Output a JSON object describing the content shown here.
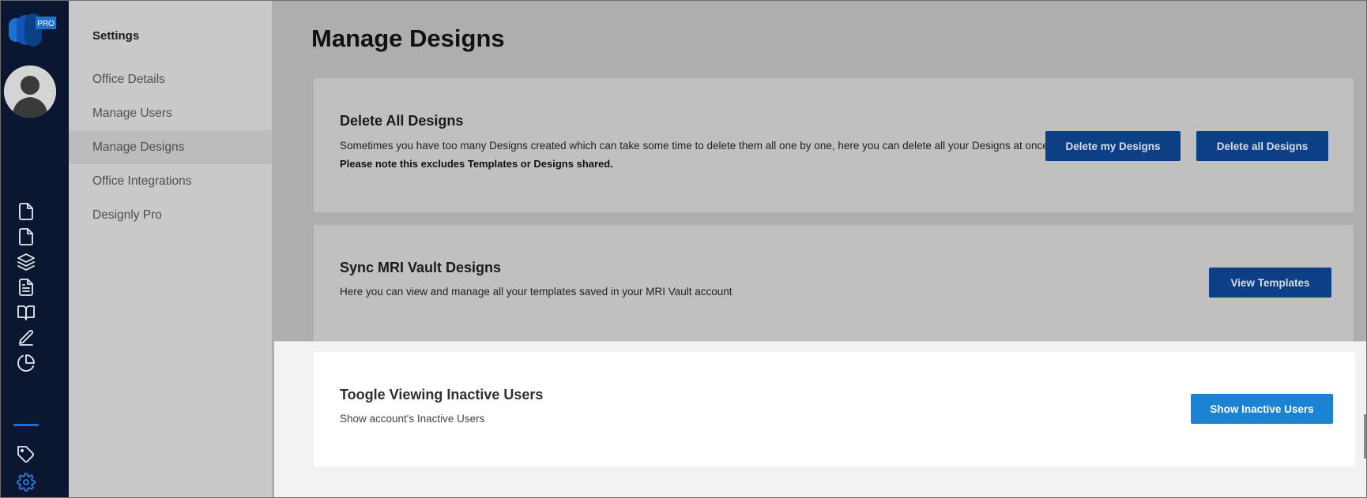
{
  "app": {
    "badge": "PRO"
  },
  "settings": {
    "title": "Settings",
    "items": [
      {
        "label": "Office Details",
        "selected": false
      },
      {
        "label": "Manage Users",
        "selected": false
      },
      {
        "label": "Manage Designs",
        "selected": true
      },
      {
        "label": "Office Integrations",
        "selected": false
      },
      {
        "label": "Designly Pro",
        "selected": false
      }
    ]
  },
  "rail": {
    "icons": [
      "document-icon",
      "document-icon",
      "layers-icon",
      "file-text-icon",
      "book-open-icon",
      "edit-icon",
      "pie-chart-icon",
      "tag-icon",
      "settings-icon"
    ]
  },
  "main": {
    "title": "Manage Designs",
    "cards": [
      {
        "title": "Delete All Designs",
        "description": "Sometimes you have too many Designs created which can take some time to delete them all one by one, here you can delete all your Designs at once.",
        "note": "Please note this excludes Templates or Designs shared.",
        "buttons": [
          "Delete my Designs",
          "Delete all Designs"
        ]
      },
      {
        "title": "Sync MRI Vault Designs",
        "description": "Here you can view and manage all your templates saved in your MRI Vault account",
        "buttons": [
          "View Templates"
        ]
      },
      {
        "title": "Toogle Viewing Inactive Users",
        "description": "Show account's Inactive Users",
        "buttons": [
          "Show Inactive Users"
        ]
      }
    ]
  },
  "colors": {
    "rail": "#0b1730",
    "sidebar": "#c9c9c9",
    "primary_button": "#0d3f86",
    "active_button": "#1a84d2",
    "accent": "#1e6fd1"
  }
}
